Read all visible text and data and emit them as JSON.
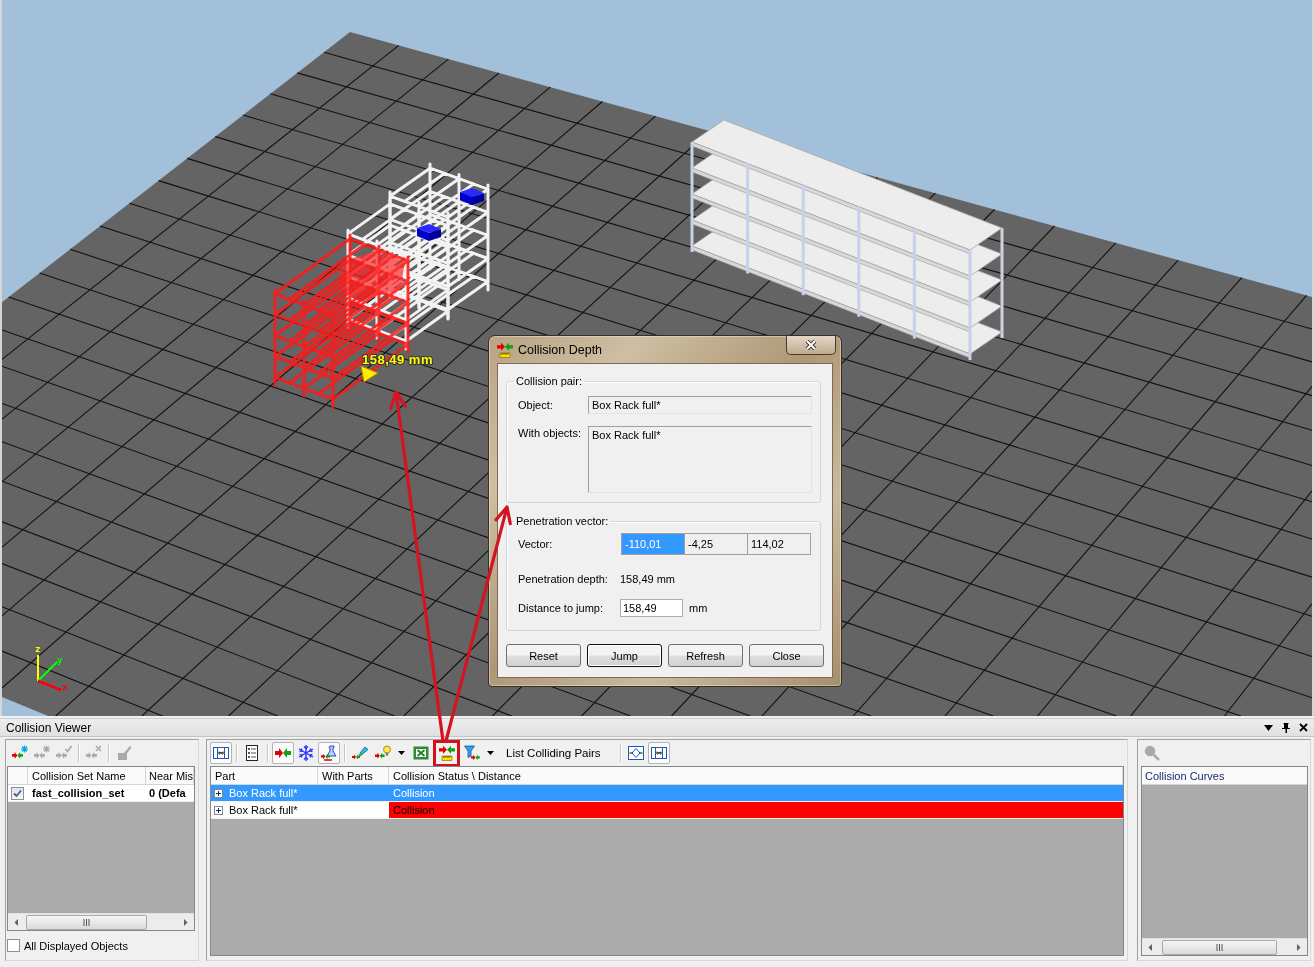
{
  "viewport": {
    "measurement": "158,49 mm",
    "axes": [
      {
        "label": "z",
        "color": "#ffff00"
      },
      {
        "label": "y",
        "color": "#00ff00"
      },
      {
        "label": "x",
        "color": "#ff0000"
      }
    ]
  },
  "dialog": {
    "title": "Collision Depth",
    "collision_pair": {
      "legend": "Collision pair:",
      "object_label": "Object:",
      "object": "Box Rack full*",
      "with_objects_label": "With objects:",
      "with_objects": "Box Rack full*"
    },
    "penetration_vector": {
      "legend": "Penetration vector:",
      "vector_label": "Vector:",
      "components": [
        {
          "value": "-110,01",
          "selected": true
        },
        {
          "value": "-4,25",
          "selected": false
        },
        {
          "value": "114,02",
          "selected": false
        }
      ],
      "depth_label": "Penetration depth:",
      "depth": "158,49 mm",
      "distance_label": "Distance to jump:",
      "distance": "158,49",
      "distance_unit": "mm"
    },
    "buttons": [
      {
        "label": "Reset",
        "default": false
      },
      {
        "label": "Jump",
        "default": true
      },
      {
        "label": "Refresh",
        "default": false
      },
      {
        "label": "Close",
        "default": false
      }
    ]
  },
  "collision_viewer": {
    "title": "Collision Viewer",
    "sets": {
      "tools": [
        {
          "kind": "new-set",
          "disabled": false
        },
        {
          "kind": "edit-set",
          "disabled": true
        },
        {
          "kind": "delete-set",
          "disabled": true
        },
        {
          "kind": "separator"
        },
        {
          "kind": "merge",
          "disabled": true
        },
        {
          "kind": "separator"
        },
        {
          "kind": "paint",
          "disabled": true
        }
      ],
      "columns": [
        "Collision Set Name",
        "Near Mis"
      ],
      "rows": [
        {
          "checked": true,
          "name": "fast_collision_set",
          "near_miss": "0 (Defa"
        }
      ],
      "all_displayed": {
        "label": "All Displayed Objects",
        "checked": false
      }
    },
    "results": {
      "tools": [
        {
          "kind": "columns",
          "pressed": true
        },
        {
          "kind": "separator"
        },
        {
          "kind": "list",
          "pressed": false
        },
        {
          "kind": "separator"
        },
        {
          "kind": "arrows",
          "pressed": true
        },
        {
          "kind": "snowflake",
          "pressed": false
        },
        {
          "kind": "flask",
          "pressed": true
        },
        {
          "kind": "separator"
        },
        {
          "kind": "flashlight",
          "pressed": false
        },
        {
          "kind": "bulb",
          "pressed": false,
          "dropdown": true
        },
        {
          "kind": "spreadsheet",
          "pressed": false
        },
        {
          "kind": "depth",
          "pressed": false,
          "highlighted": true
        },
        {
          "kind": "filter",
          "pressed": false,
          "dropdown": true
        },
        {
          "kind": "label",
          "label": "List Colliding Pairs"
        },
        {
          "kind": "separator"
        },
        {
          "kind": "fit",
          "pressed": false
        },
        {
          "kind": "columns",
          "pressed": true
        }
      ],
      "columns": [
        "Part",
        "With Parts",
        "Collision Status \\ Distance"
      ],
      "rows": [
        {
          "expanded": false,
          "part": "Box Rack full*",
          "status": "Collision",
          "selected": true
        },
        {
          "expanded": false,
          "part": "Box Rack full*",
          "status": "Collision",
          "selected": false,
          "color": "#ff0000"
        }
      ]
    },
    "curves": {
      "tools": [
        {
          "kind": "search",
          "disabled": true
        }
      ],
      "columns": [
        "Collision Curves"
      ]
    }
  }
}
